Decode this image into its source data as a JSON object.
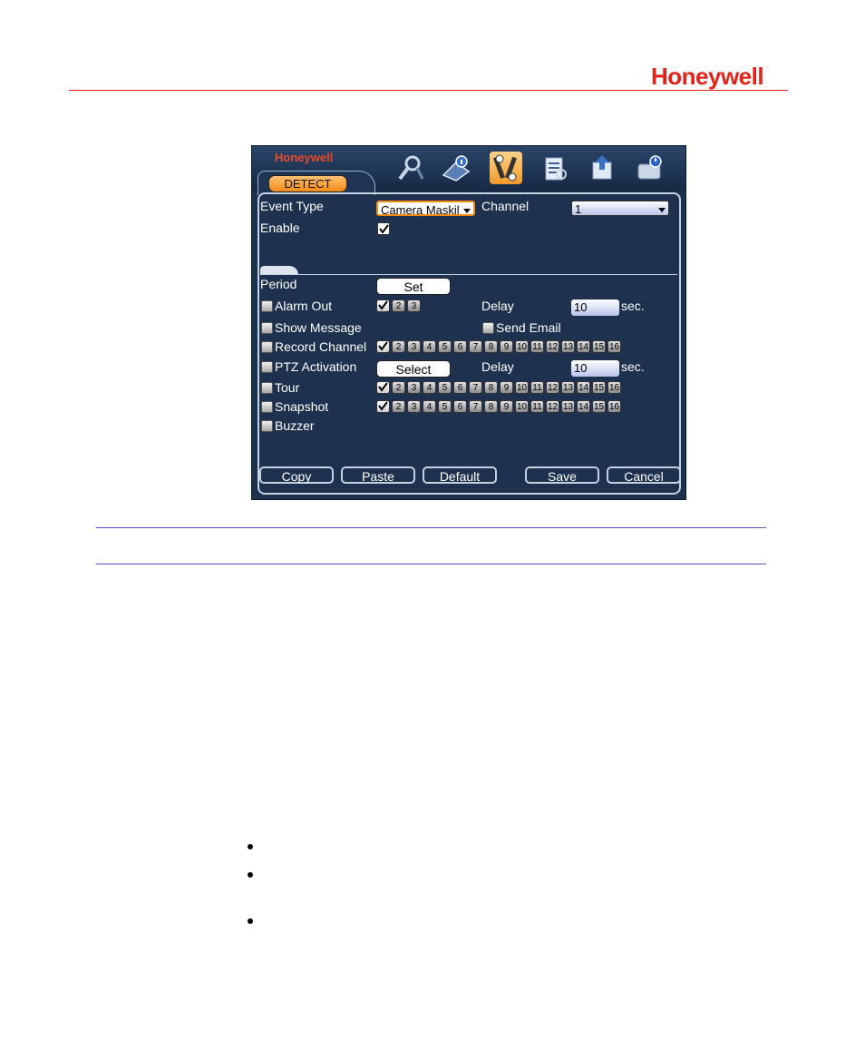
{
  "header": {
    "brand": "Honeywell"
  },
  "dvr": {
    "logo": "Honeywell",
    "active_tab": "DETECT",
    "toolbar_icons": [
      "search-icon",
      "info-icon",
      "setting-icon",
      "advanced-icon",
      "backup-icon",
      "shutdown-icon"
    ],
    "selected_icon": "setting-icon",
    "event_type": {
      "label": "Event Type",
      "value": "Camera Maskil"
    },
    "channel": {
      "label": "Channel",
      "value": "1"
    },
    "enable": {
      "label": "Enable",
      "checked": true
    },
    "period": {
      "label": "Period",
      "button": "Set"
    },
    "alarm_out": {
      "label": "Alarm Out",
      "outputs": [
        "2",
        "3"
      ],
      "first_checked": true
    },
    "delay1": {
      "label": "Delay",
      "value": "10",
      "unit": "sec."
    },
    "show_message": {
      "label": "Show Message"
    },
    "send_email": {
      "label": "Send Email"
    },
    "record_channel": {
      "label": "Record Channel"
    },
    "ptz_activation": {
      "label": "PTZ Activation",
      "button": "Select"
    },
    "delay2": {
      "label": "Delay",
      "value": "10",
      "unit": "sec."
    },
    "tour": {
      "label": "Tour"
    },
    "snapshot": {
      "label": "Snapshot"
    },
    "buzzer": {
      "label": "Buzzer"
    },
    "channels": [
      "2",
      "3",
      "4",
      "5",
      "6",
      "7",
      "8",
      "9",
      "10",
      "11",
      "12",
      "13",
      "14",
      "15",
      "16"
    ],
    "buttons": {
      "copy": "Copy",
      "paste": "Paste",
      "default": "Default",
      "save": "Save",
      "cancel": "Cancel"
    }
  },
  "colors": {
    "brand_red": "#e2231a",
    "panel_bg": "#1e3250",
    "accent_orange": "#f28a18",
    "rule_blue": "#5b4fd6"
  }
}
